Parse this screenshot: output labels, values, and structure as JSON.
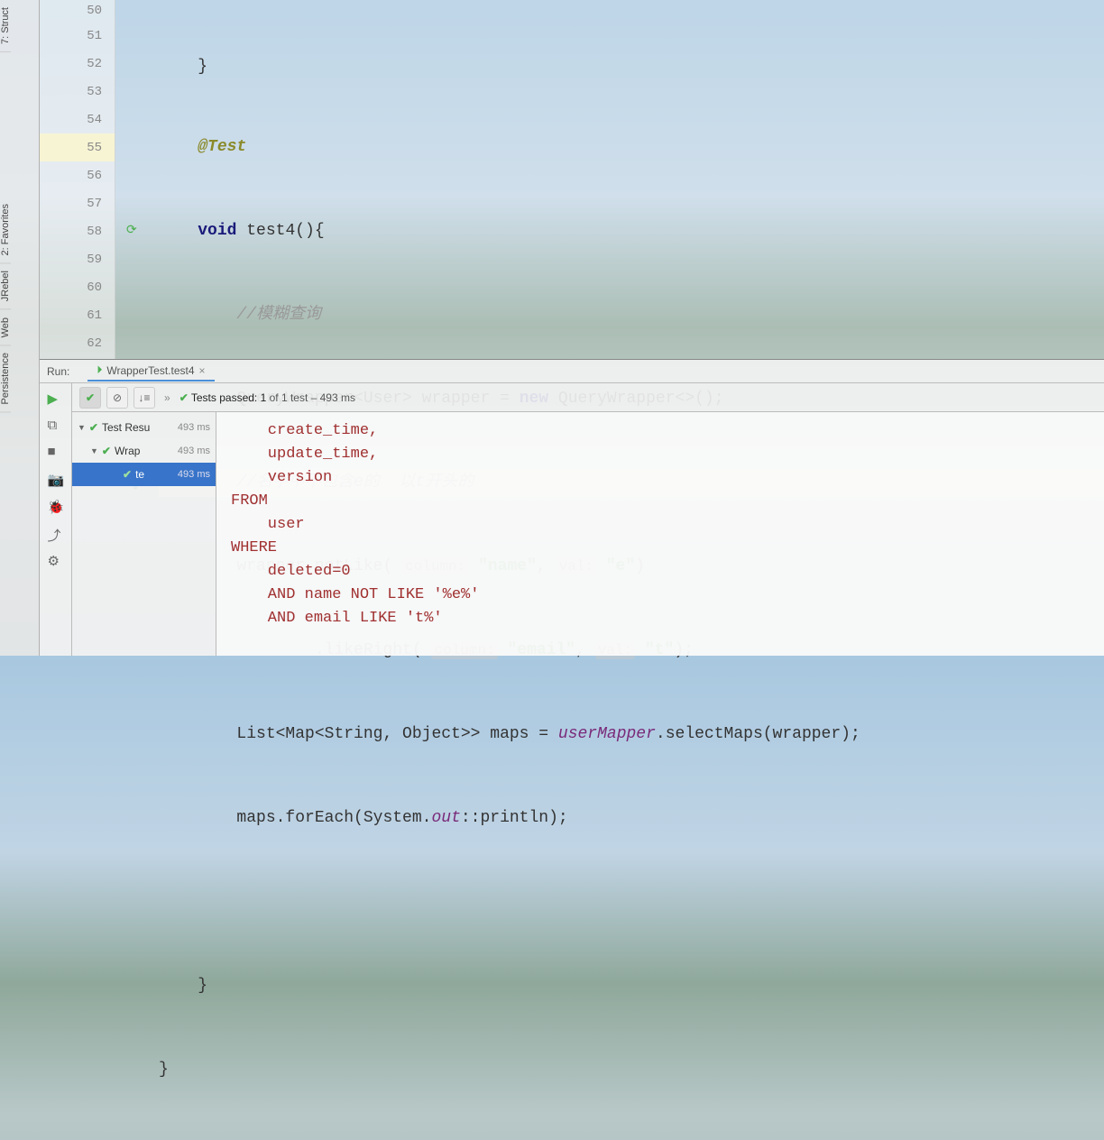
{
  "left_rail": {
    "structure": "7: Struct",
    "favorites": "2: Favorites",
    "jrebel": "JRebel",
    "web": "Web",
    "persistence": "Persistence"
  },
  "gutter": {
    "lines": [
      "50",
      "51",
      "52",
      "53",
      "54",
      "55",
      "56",
      "57",
      "58",
      "59",
      "60",
      "61",
      "62"
    ]
  },
  "code": {
    "l50": "    }",
    "l51_ann": "@Test",
    "l52_kw": "void",
    "l52_rest": " test4(){",
    "l53_cmt": "//模糊查询",
    "l54_a": "QueryWrapper<User> wrapper = ",
    "l54_kw": "new",
    "l54_b": " QueryWrapper<>();",
    "l55_cmt": "//名字中不包含e的  以t开头的",
    "l56_a": "wrapper.notLike( ",
    "l56_h1": "column:",
    "l56_s1": " \"name\"",
    "l56_b": ", ",
    "l56_h2": "val:",
    "l56_s2": " \"e\"",
    "l56_c": ")",
    "l57_a": "        .likeRight( ",
    "l57_h1": "column:",
    "l57_s1": " \"email\"",
    "l57_b": ", ",
    "l57_h2": "val:",
    "l57_s2": " \"t\"",
    "l57_c": ");",
    "l58_a": "List<Map<String, Object>> maps = ",
    "l58_f": "userMapper",
    "l58_b": ".selectMaps(wrapper);",
    "l59_a": "maps.forEach(System.",
    "l59_f": "out",
    "l59_b": "::println);",
    "l60": "",
    "l61": "    }",
    "l62": "}"
  },
  "run": {
    "label": "Run:",
    "tab": "WrapperTest.test4",
    "status_prefix": "Tests passed: 1",
    "status_suffix": " of 1 test – 493 ms",
    "tree": {
      "root": "Test Resu",
      "root_time": "493 ms",
      "mid": "Wrap",
      "mid_time": "493 ms",
      "leaf": "te",
      "leaf_time": "493 ms"
    },
    "console": "    create_time,\n    update_time,\n    version \nFROM\n    user \nWHERE\n    deleted=0 \n    AND name NOT LIKE '%e%' \n    AND email LIKE 't%'"
  }
}
